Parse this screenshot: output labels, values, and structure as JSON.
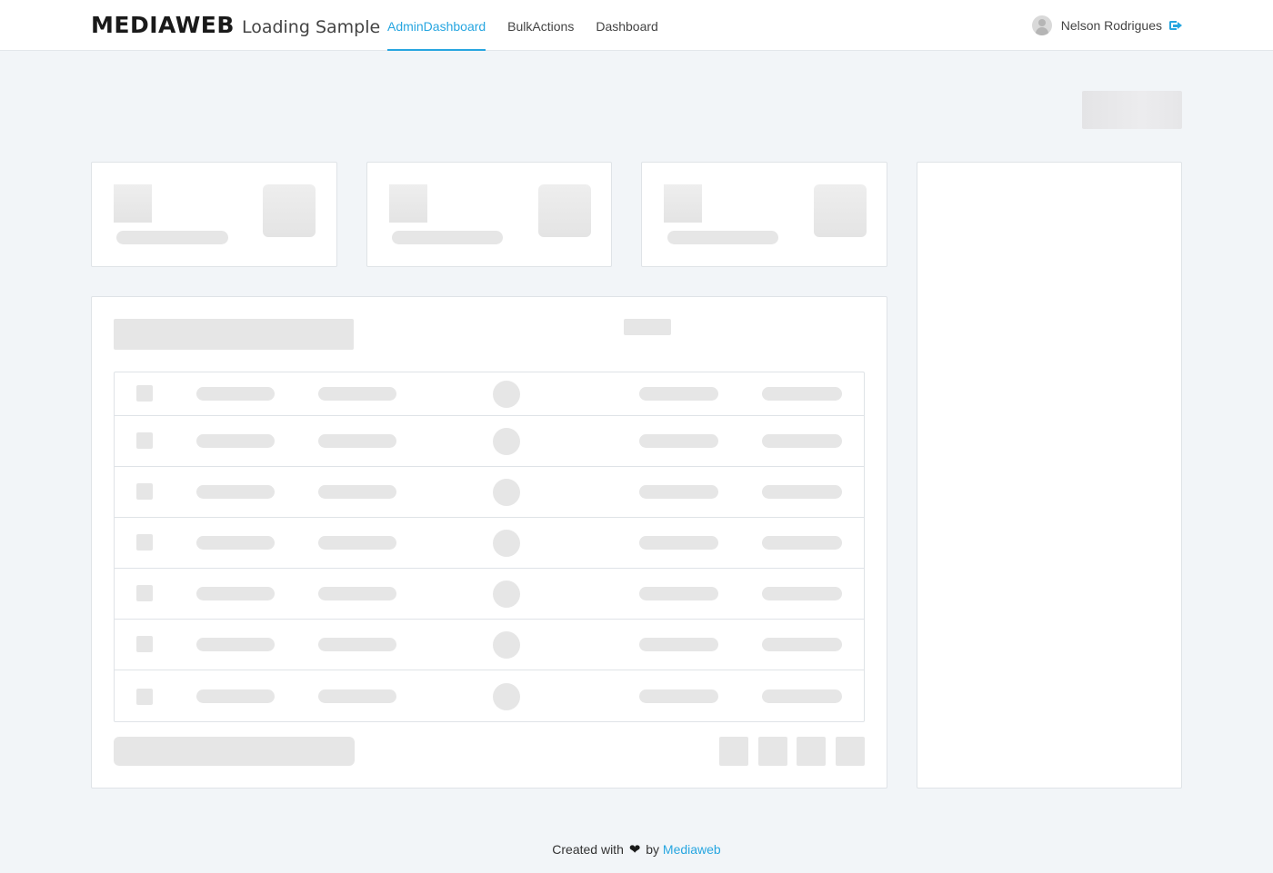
{
  "header": {
    "brand": "MEDIAWEB",
    "subtitle": "Loading Sample",
    "tabs": [
      {
        "label": "AdminDashboard",
        "active": true
      },
      {
        "label": "BulkActions",
        "active": false
      },
      {
        "label": "Dashboard",
        "active": false
      }
    ],
    "user": {
      "name": "Nelson Rodrigues",
      "logout_icon": "sign-out-icon"
    }
  },
  "main": {
    "stat_cards_count": 3,
    "table_rows_count": 7,
    "pagination_buttons_count": 4
  },
  "footer": {
    "prefix": "Created with",
    "icon": "heart-icon",
    "by": "by",
    "link": "Mediaweb"
  },
  "colors": {
    "accent": "#27a6e0",
    "background": "#f2f5f8",
    "skeleton": "#e6e6e6"
  }
}
